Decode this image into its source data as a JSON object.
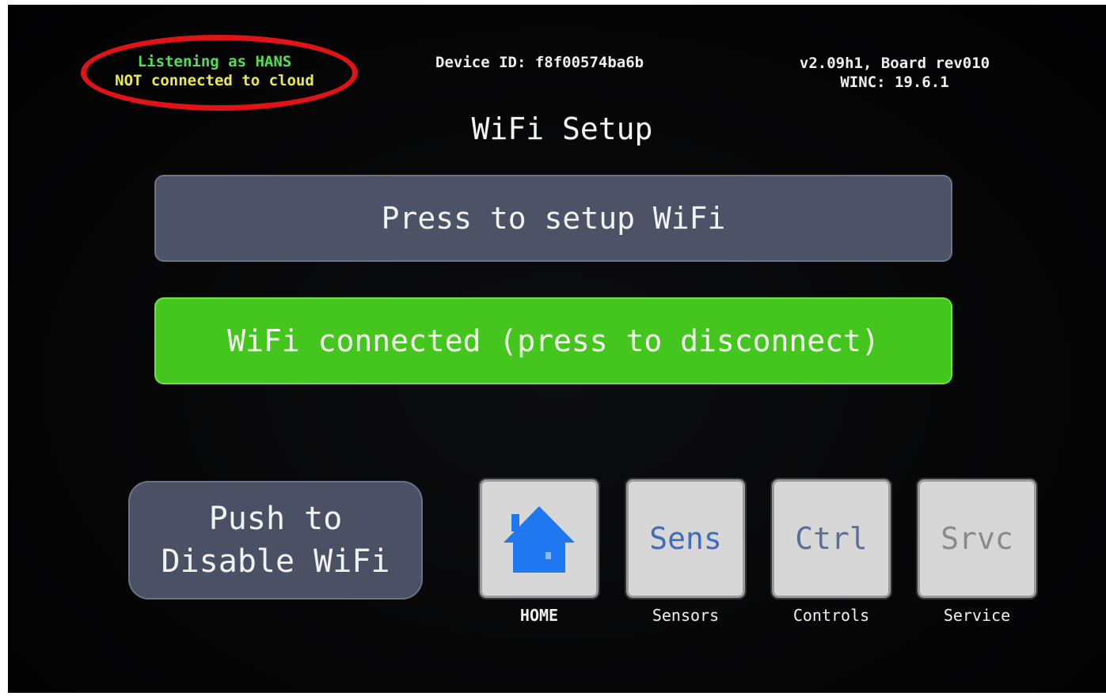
{
  "status": {
    "listening": "Listening as HANS",
    "cloud": "NOT connected to cloud"
  },
  "device": {
    "id_label": "Device ID: f8f00574ba6b"
  },
  "version": {
    "line1": "v2.09h1, Board rev010",
    "line2": "WINC: 19.6.1"
  },
  "page_title": "WiFi Setup",
  "buttons": {
    "setup": "Press to setup WiFi",
    "connected": "WiFi connected (press to disconnect)",
    "disable_line1": "Push to",
    "disable_line2": "Disable WiFi"
  },
  "nav": [
    {
      "key": "home",
      "button": "",
      "label": "HOME",
      "icon": "home-icon"
    },
    {
      "key": "sens",
      "button": "Sens",
      "label": "Sensors"
    },
    {
      "key": "ctrl",
      "button": "Ctrl",
      "label": "Controls"
    },
    {
      "key": "srvc",
      "button": "Srvc",
      "label": "Service"
    }
  ],
  "colors": {
    "listening_green": "#52e052",
    "cloud_yellow": "#eaea4a",
    "annotation_red": "#e01414",
    "connected_green": "#44c61e",
    "button_slate": "#4c5366",
    "nav_button_bg": "#d7d7d7",
    "home_icon_blue": "#1f78f0",
    "sens_text": "#3f6dbb",
    "ctrl_text": "#5a6f9a",
    "srvc_text": "#8a8a8a"
  }
}
